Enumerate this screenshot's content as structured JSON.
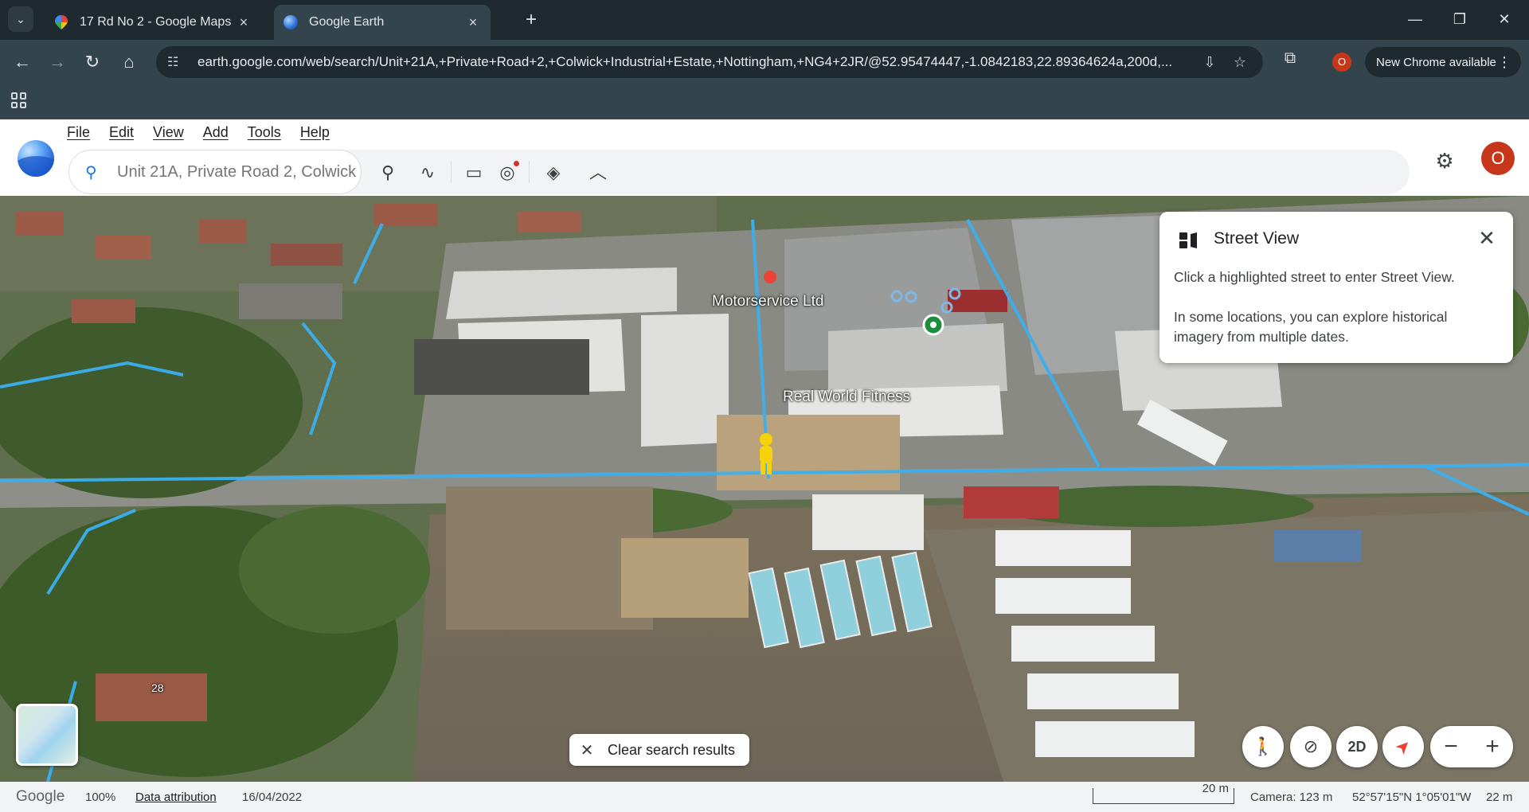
{
  "browser": {
    "tabs": [
      {
        "title": "17 Rd No 2 - Google Maps",
        "close": "×",
        "favicon": "google-maps-pin-icon"
      },
      {
        "title": "Google Earth",
        "close": "×",
        "favicon": "google-earth-icon"
      }
    ],
    "tab_search_glyph": "⌄",
    "new_tab_glyph": "+",
    "window_controls": {
      "minimize": "—",
      "maximize": "❐",
      "close": "✕"
    },
    "nav": {
      "back": "←",
      "forward": "→",
      "reload": "↻",
      "home": "⌂"
    },
    "url": "earth.google.com/web/search/Unit+21A,+Private+Road+2,+Colwick+Industrial+Estate,+Nottingham,+NG4+2JR/@52.95474447,-1.0842183,22.89364624a,200d,...",
    "omnibox_icons": {
      "install": "⇩",
      "bookmark": "☆"
    },
    "extensions_glyph": "⧉",
    "profile_initial": "O",
    "update_chip": {
      "label": "New Chrome available",
      "more": "⋮"
    }
  },
  "earth": {
    "menu": [
      "File",
      "Edit",
      "View",
      "Add",
      "Tools",
      "Help"
    ],
    "search": {
      "placeholder": "Unit 21A, Private Road 2, Colwick",
      "icon": "search-icon"
    },
    "tools": {
      "placemark": "⚲",
      "path": "∿",
      "measure": "▭",
      "voyager": "◎",
      "layers": "◈",
      "collapse": "︿"
    },
    "settings_glyph": "⚙",
    "account_initial": "O"
  },
  "map": {
    "labels": {
      "motorservice": "Motorservice Ltd",
      "fitness": "Real World Fitness",
      "house_number": "28"
    },
    "street_view": {
      "title": "Street View",
      "close": "✕",
      "line1": "Click a highlighted street to enter Street View.",
      "line2": "In some locations, you can explore historical imagery from multiple dates."
    },
    "clear_button": {
      "label": "Clear search results",
      "icon": "✕"
    },
    "controls": {
      "pegman": "🚶",
      "north": "⊘",
      "view_mode": "2D",
      "compass": "➤",
      "zoom_out": "−",
      "zoom_in": "+"
    }
  },
  "status": {
    "brand": "Google",
    "zoom": "100%",
    "attribution": "Data attribution",
    "date": "16/04/2022",
    "scale": "20 m",
    "camera": "Camera: 123 m",
    "coordinates": "52°57'15\"N 1°05'01\"W",
    "elevation": "22 m"
  }
}
